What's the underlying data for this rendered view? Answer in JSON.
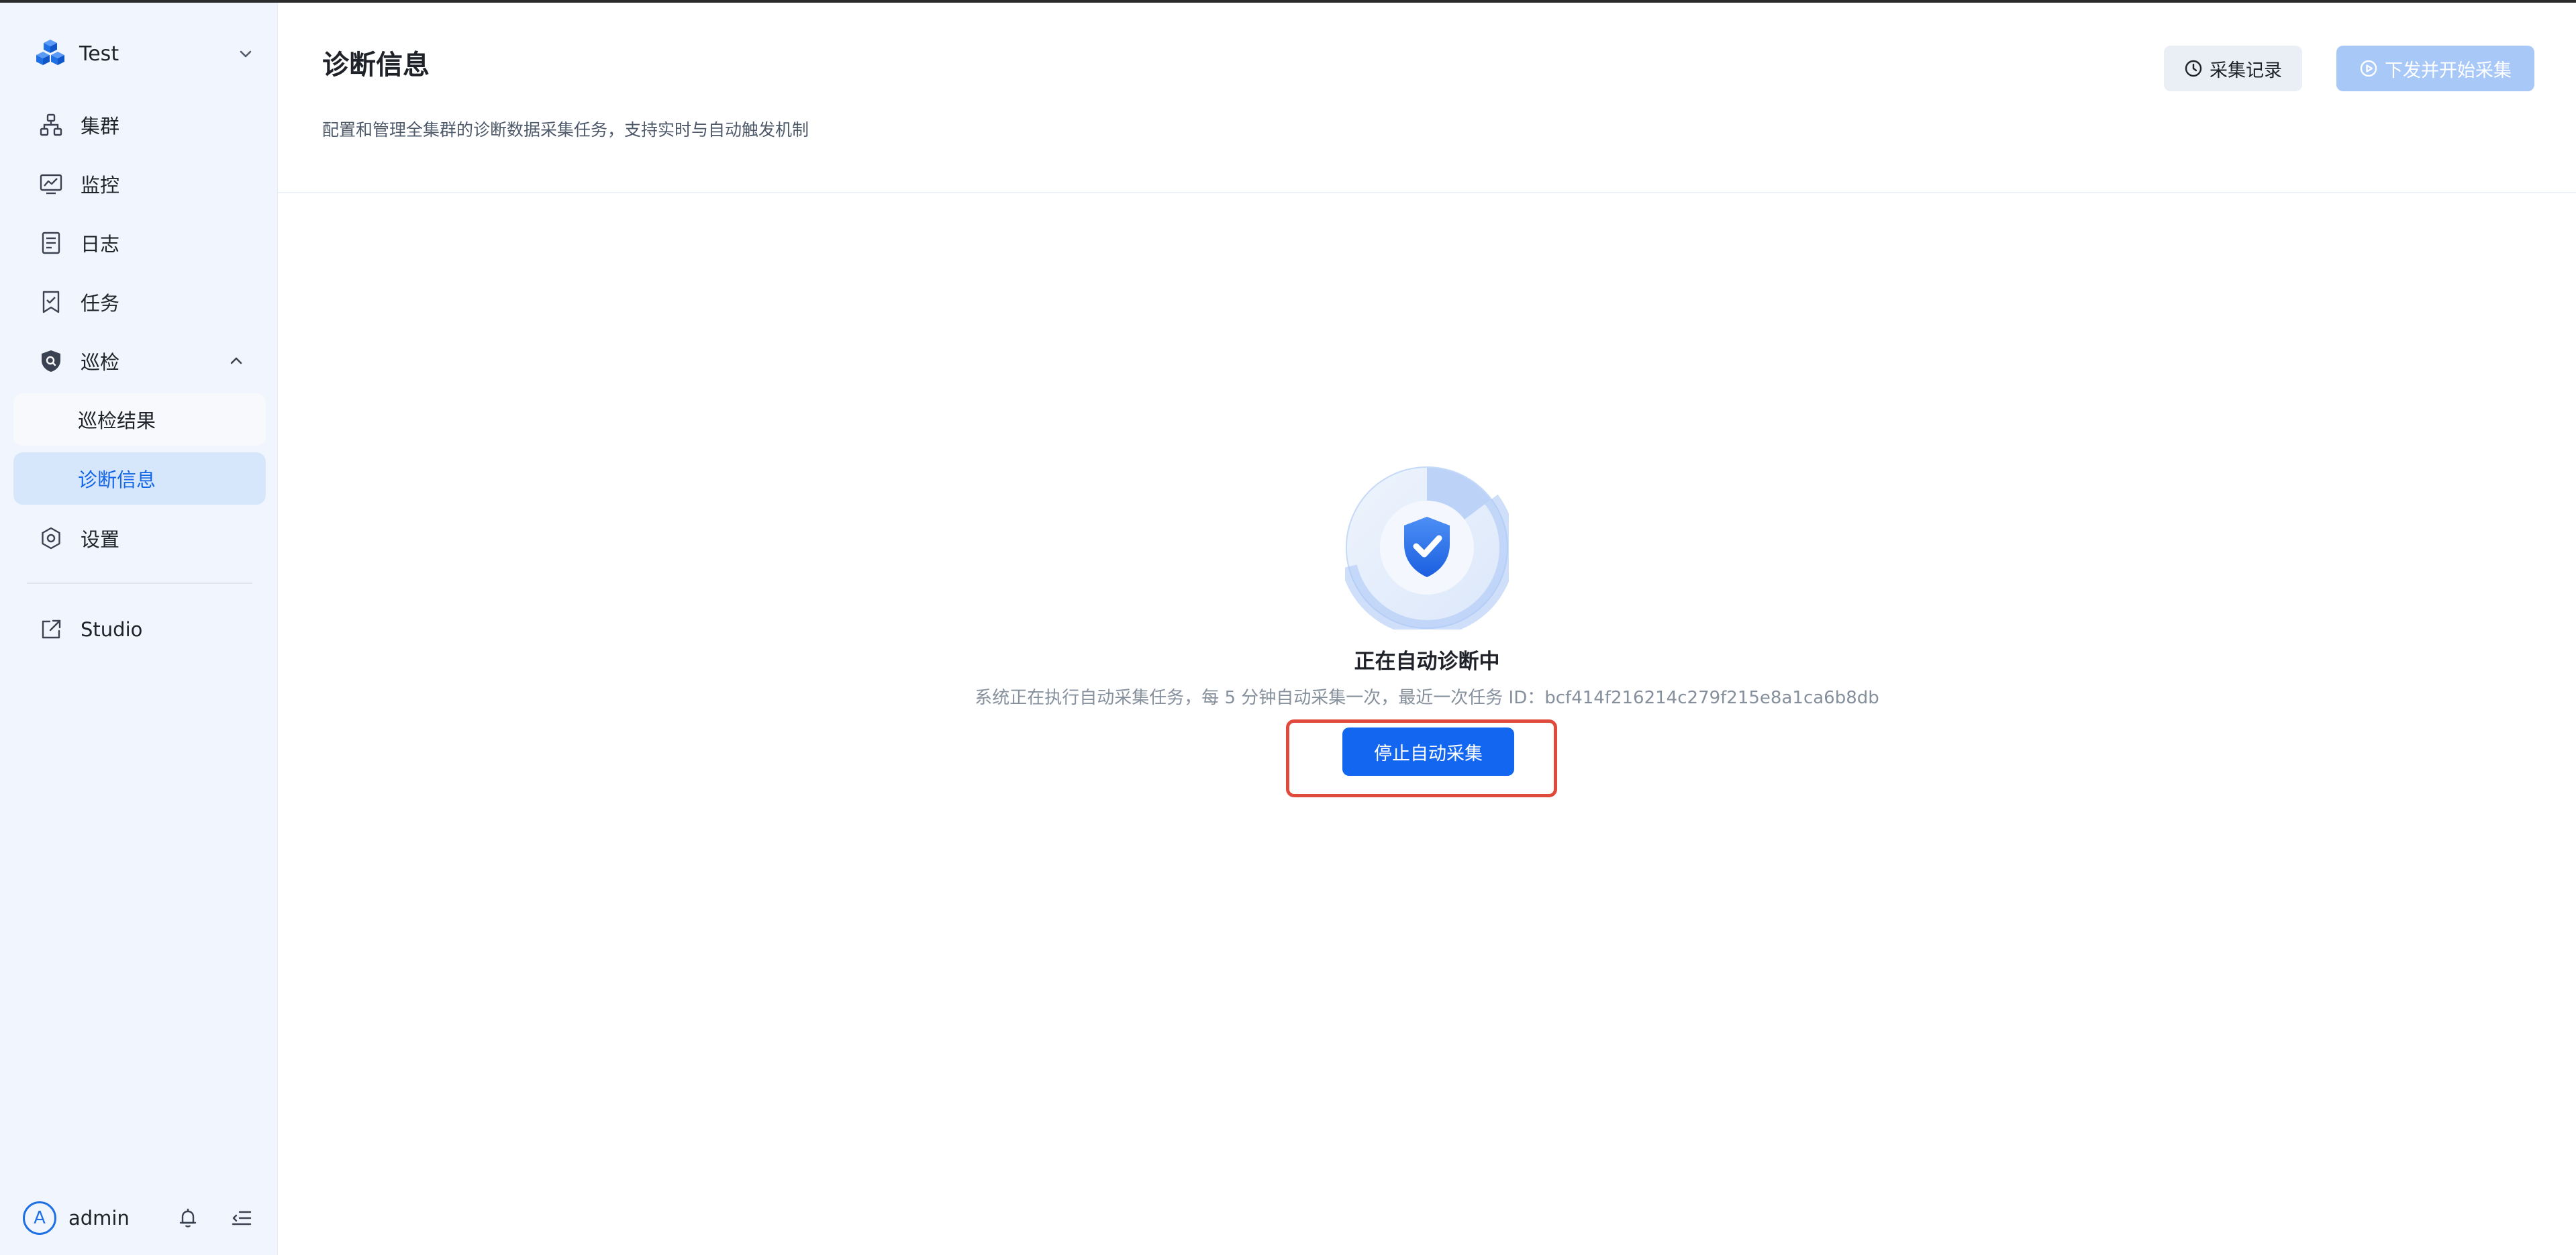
{
  "sidebar": {
    "brand": {
      "name": "Test"
    },
    "nav": {
      "cluster": "集群",
      "monitor": "监控",
      "logs": "日志",
      "tasks": "任务",
      "inspection": "巡检",
      "inspection_results": "巡检结果",
      "diagnostics": "诊断信息",
      "settings": "设置",
      "studio": "Studio"
    },
    "user": {
      "avatar_letter": "A",
      "name": "admin"
    }
  },
  "header": {
    "title": "诊断信息",
    "description": "配置和管理全集群的诊断数据采集任务，支持实时与自动触发机制",
    "history_button": "采集记录",
    "start_button": "下发并开始采集"
  },
  "status": {
    "title": "正在自动诊断中",
    "description": "系统正在执行自动采集任务，每 5 分钟自动采集一次，最近一次任务 ID：bcf414f216214c279f215e8a1ca6b8db",
    "stop_button": "停止自动采集"
  },
  "colors": {
    "accent": "#1366f0",
    "sidebar_bg": "#f1f6fe",
    "active_bg": "#d6e6fb",
    "highlight": "#e04a3a"
  }
}
